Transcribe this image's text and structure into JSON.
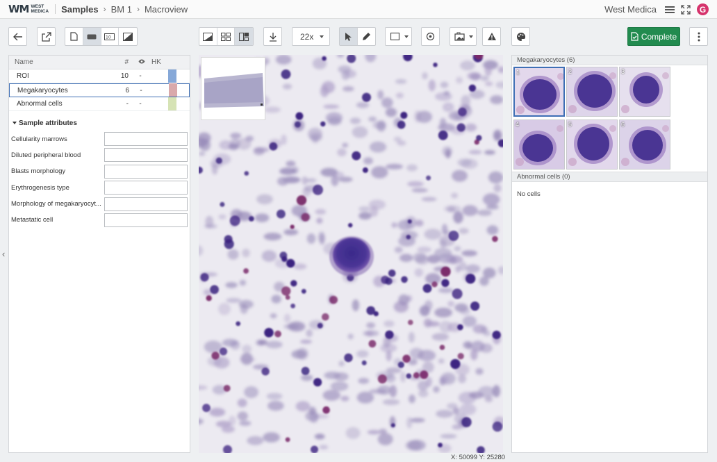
{
  "header": {
    "logo_mark": "WM",
    "logo_line1": "WEST",
    "logo_line2": "MEDICA",
    "breadcrumb": [
      "Samples",
      "BM 1",
      "Macroview"
    ],
    "org_name": "West Medica",
    "avatar_letter": "G",
    "avatar_color": "#d6336c"
  },
  "toolbar": {
    "zoom": "22x",
    "complete_label": "Complete",
    "complete_color": "#228b4f",
    "icons": [
      "back-arrow-icon",
      "external-link-icon",
      "page-icon",
      "slide-icon",
      "scalebar-icon",
      "contrast-icon",
      "split-view-icon",
      "grid-view-icon",
      "compare-view-icon",
      "download-icon",
      "pointer-icon",
      "pencil-icon",
      "rectangle-icon",
      "target-icon",
      "image-settings-icon",
      "warning-icon",
      "palette-icon",
      "kebab-menu-icon"
    ]
  },
  "left_panel": {
    "columns": {
      "name": "Name",
      "count": "#",
      "hk": "HK"
    },
    "rows": [
      {
        "name": "ROI",
        "count": "10",
        "visible": "-",
        "color": "#86a8d8"
      },
      {
        "name": "Megakaryocytes",
        "count": "6",
        "visible": "-",
        "color": "#d9a9ab"
      },
      {
        "name": "Abnormal cells",
        "count": "-",
        "visible": "-",
        "color": "#d6e3b5"
      }
    ],
    "attributes_title": "Sample attributes",
    "attributes": [
      {
        "label": "Cellularity marrows",
        "type": "select",
        "value": ""
      },
      {
        "label": "Diluted peripheral blood",
        "type": "select",
        "value": ""
      },
      {
        "label": "Blasts morphology",
        "type": "text",
        "value": ""
      },
      {
        "label": "Erythrogenesis type",
        "type": "select",
        "value": ""
      },
      {
        "label": "Morphology of megakaryocyt...",
        "type": "text",
        "value": ""
      },
      {
        "label": "Metastatic cell",
        "type": "select",
        "value": ""
      }
    ]
  },
  "viewer": {
    "coords": "X: 50099  Y: 25280"
  },
  "right_panel": {
    "megakaryocytes_title": "Megakaryocytes (6)",
    "thumbnails": [
      "1",
      "2",
      "3",
      "4",
      "5",
      "6"
    ],
    "abnormal_title": "Abnormal cells (0)",
    "no_cells": "No cells"
  }
}
